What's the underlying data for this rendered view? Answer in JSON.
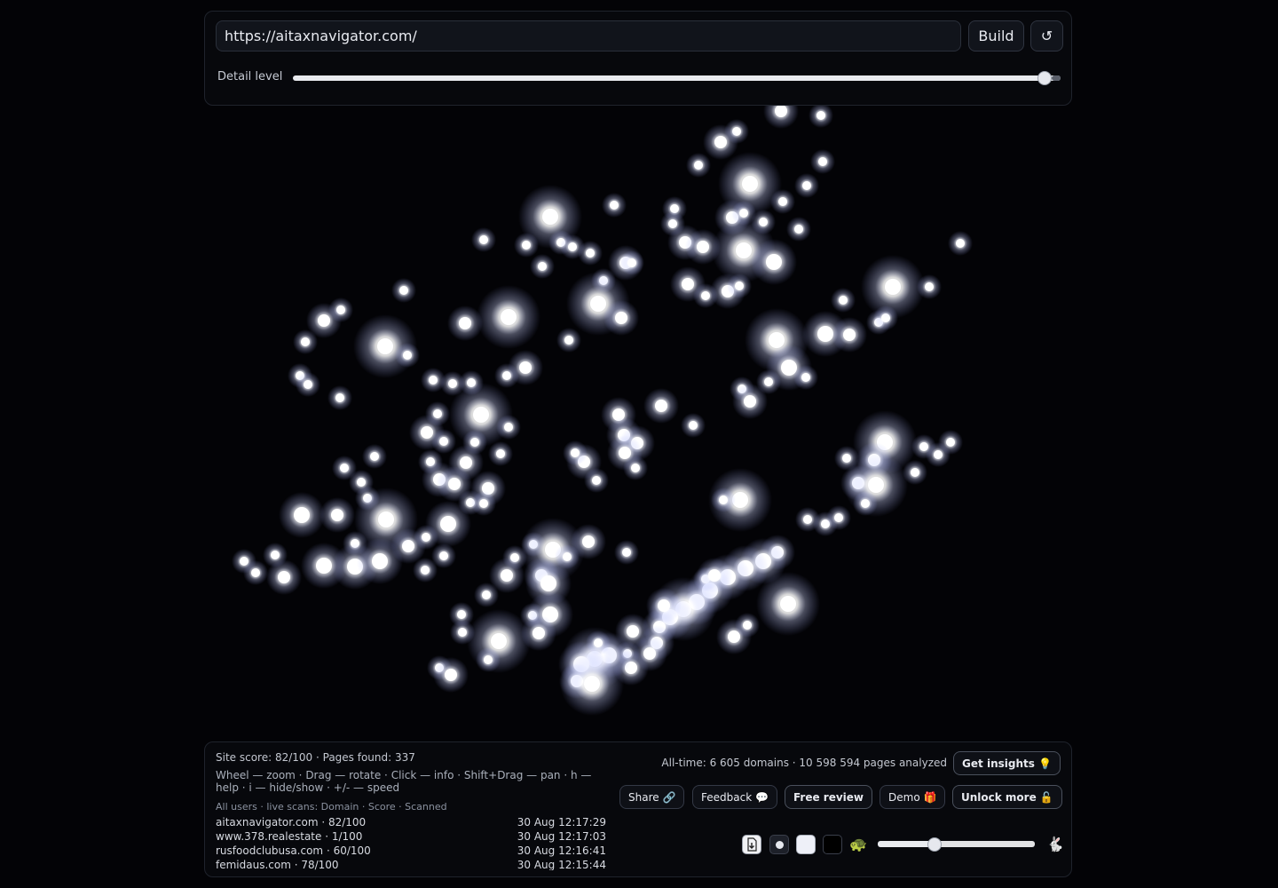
{
  "builder": {
    "url_value": "https://aitaxnavigator.com/",
    "build_label": "Build",
    "refresh_label": "↺",
    "detail_label": "Detail level",
    "detail_level": 0.98
  },
  "stats": {
    "summary": "Site score: 82/100 · Pages found: 337",
    "help": "Wheel — zoom · Drag — rotate · Click — info · Shift+Drag — pan · h — help · i — hide/show · +/- — speed",
    "scans_header": "All users · live scans: Domain · Score · Scanned",
    "scans": [
      {
        "domain": "aitaxnavigator.com · 82/100",
        "time": "30 Aug 12:17:29"
      },
      {
        "domain": "www.378.realestate · 1/100",
        "time": "30 Aug 12:17:03"
      },
      {
        "domain": "rusfoodclubusa.com · 60/100",
        "time": "30 Aug 12:16:41"
      },
      {
        "domain": "femidaus.com · 78/100",
        "time": "30 Aug 12:15:44"
      }
    ],
    "alltime": "All-time: 6 605 domains · 10 598 594 pages analyzed"
  },
  "actions": {
    "insights": "Get insights 💡",
    "share": "Share 🔗",
    "feedback": "Feedback 💬",
    "free_review": "Free review",
    "demo": "Demo 🎁",
    "unlock": "Unlock more 🔓"
  },
  "controls": {
    "export_icon": "download-icon",
    "turtle": "🐢",
    "rabbit": "🐇",
    "speed_level": 0.35
  },
  "graph": {
    "description_icon": "site-graph",
    "node_color": "#ffffff",
    "background": "#030306",
    "clusters": [
      [
        880,
        125,
        1
      ],
      [
        925,
        130,
        0
      ],
      [
        830,
        148,
        0
      ],
      [
        812,
        160,
        1
      ],
      [
        787,
        186,
        0
      ],
      [
        845,
        207,
        3
      ],
      [
        927,
        182,
        0
      ],
      [
        909,
        209,
        0
      ],
      [
        882,
        227,
        0
      ],
      [
        760,
        235,
        0
      ],
      [
        758,
        252,
        0
      ],
      [
        825,
        245,
        1
      ],
      [
        838,
        240,
        0
      ],
      [
        860,
        250,
        0
      ],
      [
        900,
        258,
        0
      ],
      [
        772,
        273,
        1
      ],
      [
        792,
        278,
        1
      ],
      [
        838,
        282,
        3
      ],
      [
        872,
        295,
        2
      ],
      [
        775,
        320,
        1
      ],
      [
        795,
        333,
        0
      ],
      [
        820,
        328,
        1
      ],
      [
        833,
        322,
        0
      ],
      [
        692,
        231,
        0
      ],
      [
        620,
        244,
        3
      ],
      [
        545,
        270,
        0
      ],
      [
        593,
        276,
        0
      ],
      [
        632,
        273,
        0
      ],
      [
        645,
        278,
        0
      ],
      [
        665,
        285,
        0
      ],
      [
        611,
        300,
        0
      ],
      [
        705,
        296,
        1
      ],
      [
        712,
        296,
        0
      ],
      [
        680,
        316,
        0
      ],
      [
        674,
        342,
        3
      ],
      [
        700,
        358,
        1
      ],
      [
        573,
        357,
        3
      ],
      [
        524,
        364,
        1
      ],
      [
        641,
        383,
        0
      ],
      [
        455,
        327,
        0
      ],
      [
        384,
        349,
        0
      ],
      [
        365,
        361,
        1
      ],
      [
        344,
        385,
        0
      ],
      [
        434,
        390,
        3
      ],
      [
        459,
        400,
        0
      ],
      [
        338,
        423,
        0
      ],
      [
        347,
        433,
        0
      ],
      [
        383,
        448,
        0
      ],
      [
        488,
        428,
        0
      ],
      [
        510,
        432,
        0
      ],
      [
        531,
        431,
        0
      ],
      [
        571,
        423,
        0
      ],
      [
        592,
        414,
        1
      ],
      [
        542,
        467,
        3
      ],
      [
        493,
        466,
        0
      ],
      [
        573,
        481,
        0
      ],
      [
        481,
        487,
        1
      ],
      [
        500,
        497,
        0
      ],
      [
        535,
        498,
        0
      ],
      [
        564,
        511,
        0
      ],
      [
        485,
        520,
        0
      ],
      [
        525,
        521,
        1
      ],
      [
        495,
        540,
        1
      ],
      [
        512,
        545,
        1
      ],
      [
        550,
        550,
        1
      ],
      [
        530,
        566,
        0
      ],
      [
        545,
        567,
        0
      ],
      [
        505,
        590,
        2
      ],
      [
        480,
        605,
        0
      ],
      [
        460,
        615,
        1
      ],
      [
        500,
        626,
        0
      ],
      [
        479,
        642,
        0
      ],
      [
        422,
        514,
        0
      ],
      [
        388,
        527,
        0
      ],
      [
        407,
        543,
        0
      ],
      [
        414,
        561,
        0
      ],
      [
        340,
        580,
        2
      ],
      [
        380,
        580,
        1
      ],
      [
        435,
        585,
        3
      ],
      [
        400,
        612,
        0
      ],
      [
        365,
        637,
        2
      ],
      [
        400,
        638,
        2
      ],
      [
        428,
        632,
        2
      ],
      [
        320,
        650,
        1
      ],
      [
        275,
        632,
        0
      ],
      [
        288,
        645,
        0
      ],
      [
        310,
        625,
        0
      ],
      [
        520,
        692,
        0
      ],
      [
        521,
        712,
        0
      ],
      [
        548,
        670,
        0
      ],
      [
        562,
        722,
        3
      ],
      [
        550,
        743,
        0
      ],
      [
        495,
        752,
        0
      ],
      [
        508,
        760,
        1
      ],
      [
        580,
        628,
        0
      ],
      [
        601,
        613,
        0
      ],
      [
        623,
        619,
        3
      ],
      [
        639,
        627,
        0
      ],
      [
        610,
        648,
        1
      ],
      [
        618,
        657,
        2
      ],
      [
        571,
        648,
        1
      ],
      [
        600,
        693,
        0
      ],
      [
        620,
        692,
        2
      ],
      [
        607,
        713,
        1
      ],
      [
        663,
        610,
        1
      ],
      [
        706,
        622,
        0
      ],
      [
        697,
        467,
        1
      ],
      [
        703,
        490,
        1
      ],
      [
        718,
        499,
        1
      ],
      [
        704,
        510,
        1
      ],
      [
        716,
        527,
        0
      ],
      [
        672,
        541,
        0
      ],
      [
        658,
        520,
        1
      ],
      [
        648,
        510,
        0
      ],
      [
        745,
        457,
        1
      ],
      [
        781,
        479,
        0
      ],
      [
        875,
        383,
        3
      ],
      [
        889,
        414,
        2
      ],
      [
        908,
        425,
        0
      ],
      [
        866,
        430,
        0
      ],
      [
        836,
        438,
        0
      ],
      [
        845,
        452,
        1
      ],
      [
        930,
        376,
        2
      ],
      [
        957,
        377,
        1
      ],
      [
        950,
        338,
        0
      ],
      [
        990,
        363,
        0
      ],
      [
        998,
        358,
        0
      ],
      [
        1006,
        323,
        3
      ],
      [
        1047,
        323,
        0
      ],
      [
        1082,
        274,
        0
      ],
      [
        997,
        498,
        3
      ],
      [
        985,
        518,
        1
      ],
      [
        954,
        516,
        0
      ],
      [
        967,
        544,
        1
      ],
      [
        987,
        546,
        3
      ],
      [
        975,
        567,
        0
      ],
      [
        1031,
        532,
        0
      ],
      [
        1041,
        503,
        0
      ],
      [
        1057,
        512,
        0
      ],
      [
        1071,
        498,
        0
      ],
      [
        910,
        585,
        0
      ],
      [
        930,
        590,
        0
      ],
      [
        945,
        583,
        0
      ],
      [
        834,
        563,
        3
      ],
      [
        815,
        563,
        0
      ],
      [
        876,
        622,
        1
      ],
      [
        860,
        632,
        2
      ],
      [
        840,
        640,
        2
      ],
      [
        820,
        650,
        2
      ],
      [
        800,
        665,
        2
      ],
      [
        785,
        678,
        2
      ],
      [
        770,
        686,
        3
      ],
      [
        755,
        695,
        2
      ],
      [
        743,
        706,
        1
      ],
      [
        713,
        711,
        1
      ],
      [
        740,
        724,
        1
      ],
      [
        732,
        736,
        1
      ],
      [
        707,
        736,
        0
      ],
      [
        711,
        752,
        1
      ],
      [
        686,
        738,
        2
      ],
      [
        670,
        742,
        3
      ],
      [
        655,
        748,
        2
      ],
      [
        650,
        767,
        1
      ],
      [
        667,
        770,
        3
      ],
      [
        674,
        724,
        0
      ],
      [
        888,
        680,
        3
      ],
      [
        827,
        717,
        1
      ],
      [
        842,
        704,
        0
      ],
      [
        795,
        652,
        0
      ],
      [
        805,
        648,
        1
      ],
      [
        748,
        682,
        1
      ]
    ]
  }
}
